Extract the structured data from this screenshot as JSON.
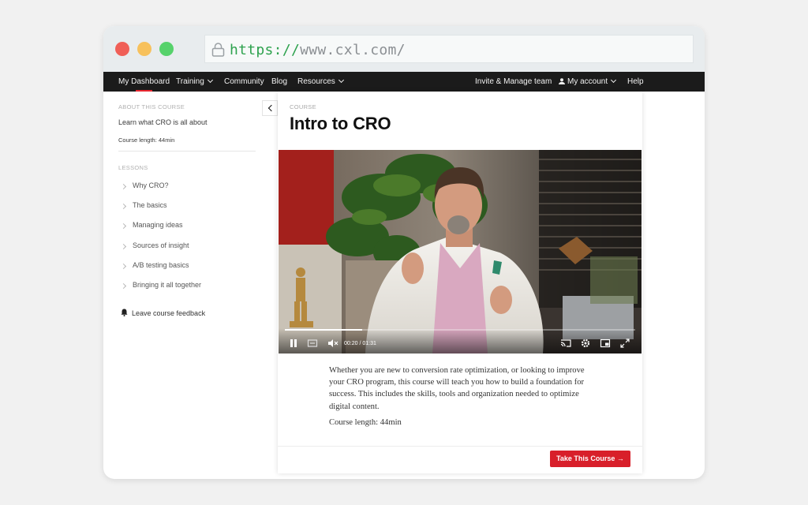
{
  "browser": {
    "url_scheme": "https://",
    "url_host": "www.cxl.com/"
  },
  "nav": {
    "my_dashboard": "My Dashboard",
    "training": "Training",
    "community": "Community",
    "blog": "Blog",
    "resources": "Resources",
    "invite_manage": "Invite & Manage team",
    "my_account": "My account",
    "help": "Help"
  },
  "sidebar": {
    "about_label": "ABOUT THIS COURSE",
    "about_text": "Learn what CRO is all about",
    "course_length": "Course length: 44min",
    "lessons_label": "LESSONS",
    "lessons": [
      {
        "label": "Why CRO?"
      },
      {
        "label": "The basics"
      },
      {
        "label": "Managing ideas"
      },
      {
        "label": "Sources of insight"
      },
      {
        "label": "A/B testing basics"
      },
      {
        "label": "Bringing it all together"
      }
    ],
    "feedback": "Leave course feedback"
  },
  "course": {
    "label": "COURSE",
    "title": "Intro to CRO",
    "video": {
      "current_time": "00:20",
      "separator": "/",
      "duration": "01:31",
      "progress": 0.22
    },
    "description": "Whether you are new to conversion rate optimization, or looking to improve your CRO program, this course will teach you how to build a foundation for success. This includes the skills, tools and organization needed to optimize digital content.",
    "length": "Course length: 44min",
    "cta": "Take This Course →"
  },
  "colors": {
    "accent": "#d81f2a",
    "nav_bg": "#1b1b1b"
  }
}
